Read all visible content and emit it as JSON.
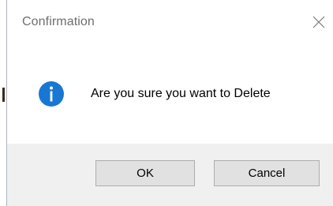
{
  "dialog": {
    "title": "Confirmation",
    "message": "Are you sure you want to Delete",
    "icon": "info-icon",
    "ok_label": "OK",
    "cancel_label": "Cancel"
  },
  "colors": {
    "icon_blue": "#1877d3",
    "footer_bg": "#f0f0f0",
    "button_bg": "#e1e1e1",
    "button_border": "#adadad"
  }
}
